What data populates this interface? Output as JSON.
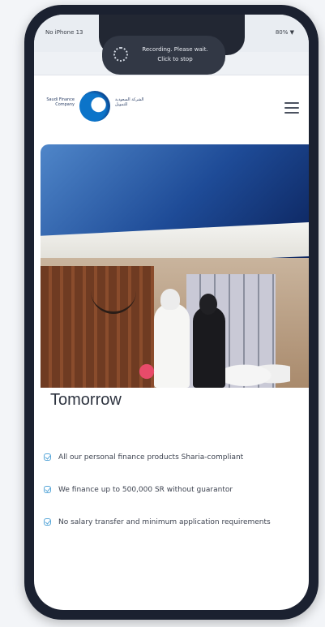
{
  "status_bar": {
    "carrier": "No iPhone 13",
    "battery": "80% ▼"
  },
  "recording": {
    "line1": "Recording. Please wait.",
    "line2": "Click to stop"
  },
  "logo": {
    "english_text": "Saudi Finance Company",
    "arabic_text": "الشركة السعودية للتمويل"
  },
  "hero": {
    "headline": "Tomorrow"
  },
  "features": [
    {
      "text": "All our personal finance products Sharia-compliant"
    },
    {
      "text": "We finance up to 500,000 SR without guarantor"
    },
    {
      "text": "No salary transfer and minimum application requirements"
    }
  ],
  "colors": {
    "accent": "#57a6d8",
    "brand_blue": "#0c74c9",
    "phone_frame": "#1b2130"
  },
  "icons": [
    "recording-icon",
    "menu-icon",
    "check-icon"
  ]
}
